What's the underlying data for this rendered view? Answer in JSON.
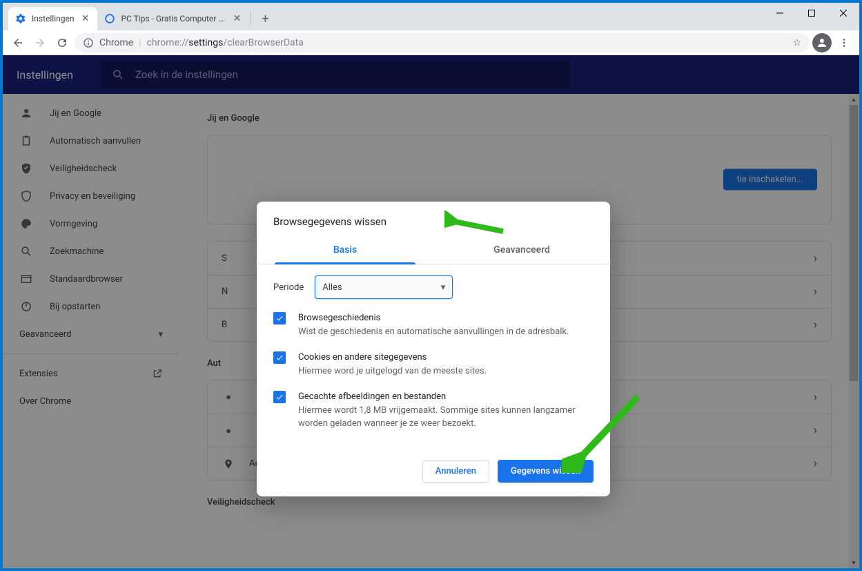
{
  "window": {
    "tabs": [
      {
        "title": "Instellingen",
        "active": true
      },
      {
        "title": "PC Tips - Gratis Computer tips, in",
        "active": false
      }
    ]
  },
  "toolbar": {
    "chrome_label": "Chrome",
    "url_prefix": "chrome://",
    "url_mid": "settings",
    "url_suffix": "/clearBrowserData"
  },
  "settings": {
    "title": "Instellingen",
    "search_placeholder": "Zoek in de instellingen",
    "sidebar": {
      "items": [
        {
          "label": "Jij en Google"
        },
        {
          "label": "Automatisch aanvullen"
        },
        {
          "label": "Veiligheidscheck"
        },
        {
          "label": "Privacy en beveiliging"
        },
        {
          "label": "Vormgeving"
        },
        {
          "label": "Zoekmachine"
        },
        {
          "label": "Standaardbrowser"
        },
        {
          "label": "Bij opstarten"
        }
      ],
      "advanced": "Geavanceerd",
      "extensions": "Extensies",
      "about": "Over Chrome"
    },
    "main": {
      "section1_title": "Jij en Google",
      "sync_button": "tie inschakelen...",
      "row_s": "S",
      "row_n": "N",
      "row_b": "B",
      "section2_title": "Aut",
      "addresses": "Adressen en meer",
      "section3_title": "Veiligheidscheck"
    }
  },
  "dialog": {
    "title": "Browsegegevens wissen",
    "tabs": {
      "basic": "Basis",
      "advanced": "Geavanceerd"
    },
    "period_label": "Periode",
    "period_value": "Alles",
    "items": [
      {
        "title": "Browsegeschiedenis",
        "desc": "Wist de geschiedenis en automatische aanvullingen in de adresbalk."
      },
      {
        "title": "Cookies en andere sitegegevens",
        "desc": "Hiermee word je uitgelogd van de meeste sites."
      },
      {
        "title": "Gecachte afbeeldingen en bestanden",
        "desc": "Hiermee wordt 1,8 MB vrijgemaakt. Sommige sites kunnen langzamer worden geladen wanneer je ze weer bezoekt."
      }
    ],
    "cancel": "Annuleren",
    "confirm": "Gegevens wissen"
  }
}
